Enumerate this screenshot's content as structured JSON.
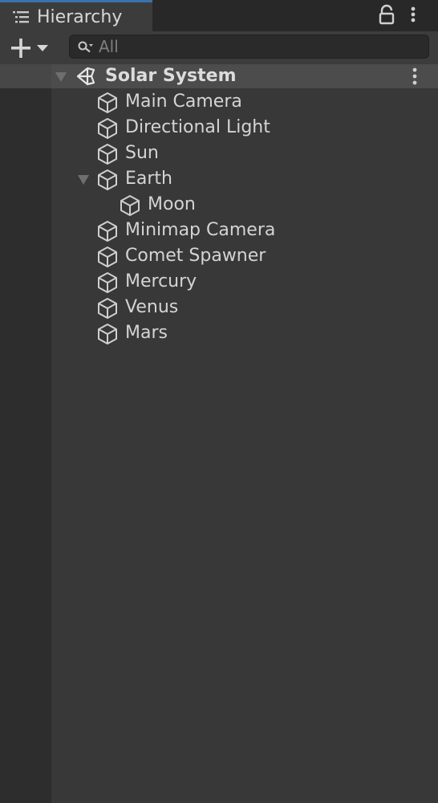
{
  "tab": {
    "title": "Hierarchy",
    "icon": "hierarchy-list-icon",
    "accent_color": "#3a72b0"
  },
  "toolbar": {
    "add_icon": "plus-dropdown-icon",
    "search": {
      "placeholder": "All",
      "value": "",
      "icon": "search-icon"
    }
  },
  "scene": {
    "name": "Solar System",
    "icon": "unity-logo-icon",
    "expanded": true
  },
  "items": [
    {
      "label": "Main Camera",
      "depth": 1,
      "expandable": false
    },
    {
      "label": "Directional Light",
      "depth": 1,
      "expandable": false
    },
    {
      "label": "Sun",
      "depth": 1,
      "expandable": false
    },
    {
      "label": "Earth",
      "depth": 1,
      "expandable": true,
      "expanded": true
    },
    {
      "label": "Moon",
      "depth": 2,
      "expandable": false
    },
    {
      "label": "Minimap Camera",
      "depth": 1,
      "expandable": false
    },
    {
      "label": "Comet Spawner",
      "depth": 1,
      "expandable": false
    },
    {
      "label": "Mercury",
      "depth": 1,
      "expandable": false
    },
    {
      "label": "Venus",
      "depth": 1,
      "expandable": false
    },
    {
      "label": "Mars",
      "depth": 1,
      "expandable": false
    }
  ]
}
